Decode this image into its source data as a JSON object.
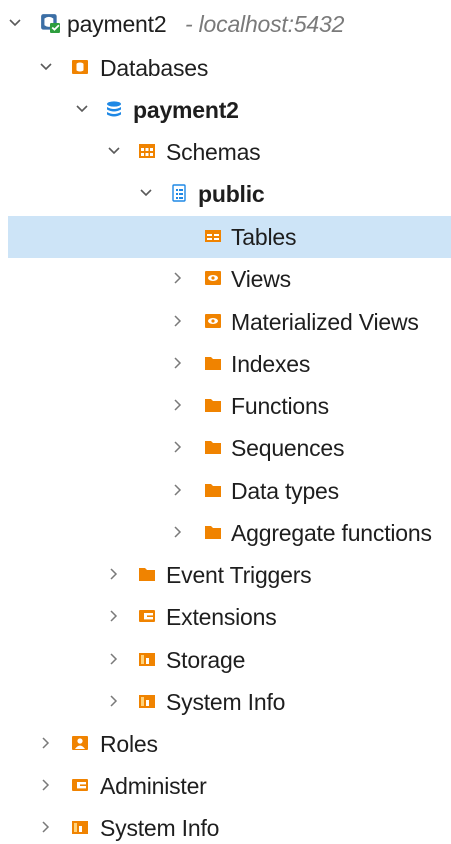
{
  "tree": {
    "server": {
      "label": "payment2",
      "host": "- localhost:5432"
    },
    "databases": {
      "label": "Databases"
    },
    "database": {
      "label": "payment2"
    },
    "schemas": {
      "label": "Schemas"
    },
    "schema": {
      "label": "public"
    },
    "items": [
      {
        "label": "Tables",
        "icon": "table-icon",
        "selected": true
      },
      {
        "label": "Views",
        "icon": "view-icon"
      },
      {
        "label": "Materialized Views",
        "icon": "view-icon"
      },
      {
        "label": "Indexes",
        "icon": "folder-icon"
      },
      {
        "label": "Functions",
        "icon": "folder-icon"
      },
      {
        "label": "Sequences",
        "icon": "folder-icon"
      },
      {
        "label": "Data types",
        "icon": "folder-icon"
      },
      {
        "label": "Aggregate functions",
        "icon": "folder-icon"
      }
    ],
    "db_children": [
      {
        "label": "Event Triggers",
        "icon": "folder-icon"
      },
      {
        "label": "Extensions",
        "icon": "extension-icon"
      },
      {
        "label": "Storage",
        "icon": "storage-icon"
      },
      {
        "label": "System Info",
        "icon": "system-info-icon"
      }
    ],
    "server_children": [
      {
        "label": "Roles",
        "icon": "roles-icon"
      },
      {
        "label": "Administer",
        "icon": "administer-icon"
      },
      {
        "label": "System Info",
        "icon": "system-info-icon"
      }
    ]
  },
  "colors": {
    "selection": "#cde4f7",
    "folder": "#f08300",
    "database_accent": "#1e88e5",
    "chevron": "#5a5a5a",
    "host_text": "#7a7a7a"
  }
}
